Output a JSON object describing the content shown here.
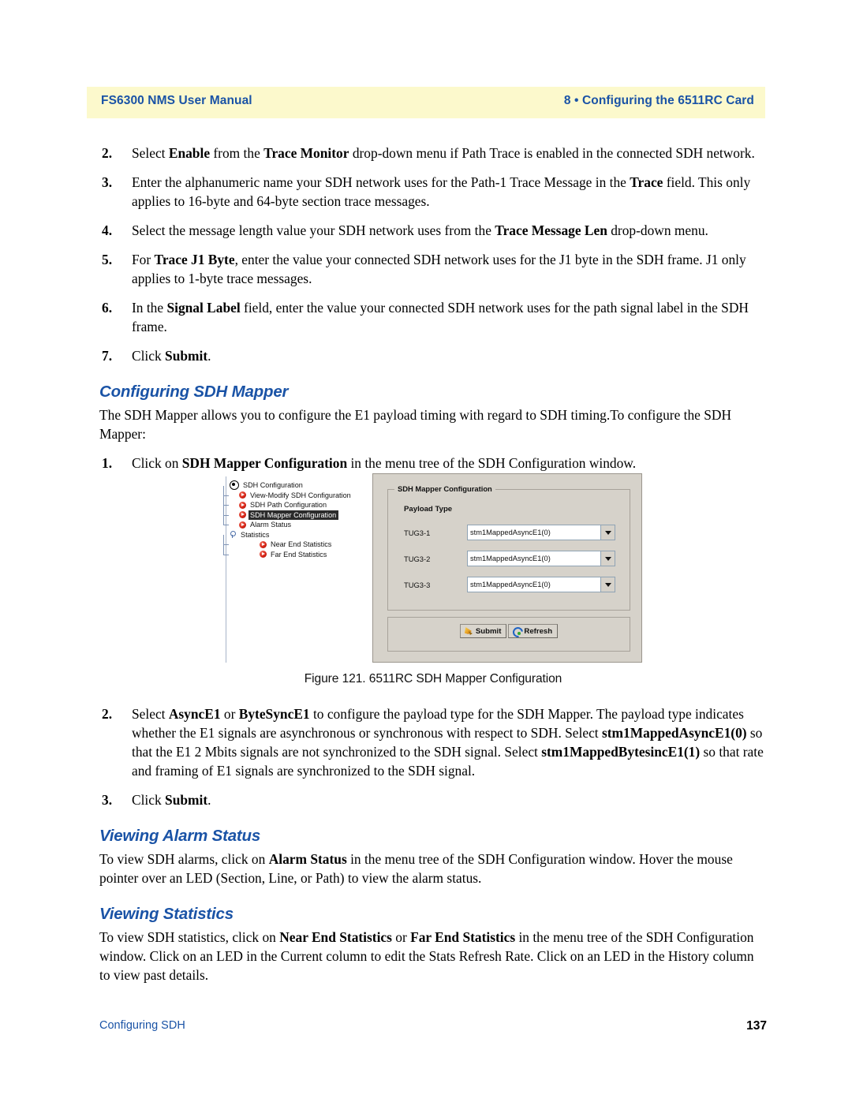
{
  "header": {
    "left": "FS6300 NMS User Manual",
    "right": "8 • Configuring the 6511RC Card",
    "band_color": "#fcf9cc",
    "text_color": "#1a53a6"
  },
  "steps_top": [
    {
      "num": "2.",
      "runs": [
        {
          "t": "Select ",
          "b": false
        },
        {
          "t": "Enable",
          "b": true
        },
        {
          "t": " from the ",
          "b": false
        },
        {
          "t": "Trace Monitor",
          "b": true
        },
        {
          "t": " drop-down menu if Path Trace is enabled in the connected SDH network.",
          "b": false
        }
      ]
    },
    {
      "num": "3.",
      "runs": [
        {
          "t": "Enter the alphanumeric name your SDH network uses for the Path-1 Trace Message in the ",
          "b": false
        },
        {
          "t": "Trace",
          "b": true
        },
        {
          "t": " field. This only applies to 16-byte and 64-byte section trace messages.",
          "b": false
        }
      ]
    },
    {
      "num": "4.",
      "runs": [
        {
          "t": "Select the message length value your SDH network uses from the ",
          "b": false
        },
        {
          "t": "Trace Message Len",
          "b": true
        },
        {
          "t": " drop-down menu.",
          "b": false
        }
      ]
    },
    {
      "num": "5.",
      "runs": [
        {
          "t": "For ",
          "b": false
        },
        {
          "t": "Trace J1 Byte",
          "b": true
        },
        {
          "t": ", enter the value your connected SDH network uses for the J1 byte in the SDH frame. J1 only applies to 1-byte trace messages.",
          "b": false
        }
      ]
    },
    {
      "num": "6.",
      "runs": [
        {
          "t": "In the ",
          "b": false
        },
        {
          "t": "Signal Label",
          "b": true
        },
        {
          "t": " field, enter the value your connected SDH network uses for the path signal label in the SDH frame.",
          "b": false
        }
      ]
    },
    {
      "num": "7.",
      "runs": [
        {
          "t": "Click ",
          "b": false
        },
        {
          "t": "Submit",
          "b": true
        },
        {
          "t": ".",
          "b": false
        }
      ]
    }
  ],
  "section_mapper": {
    "heading": "Configuring SDH Mapper",
    "intro": "The SDH Mapper allows you to configure the E1 payload timing with regard to SDH timing.To configure the SDH Mapper:",
    "step1": {
      "num": "1.",
      "runs": [
        {
          "t": "Click on ",
          "b": false
        },
        {
          "t": "SDH Mapper Configuration",
          "b": true
        },
        {
          "t": " in the menu tree of the SDH Configuration window.",
          "b": false
        }
      ]
    }
  },
  "figure": {
    "caption": "Figure 121. 6511RC SDH Mapper Configuration",
    "tree": [
      {
        "label": "SDH Configuration",
        "icon": "radio-node-icon",
        "level": 0,
        "selected": false
      },
      {
        "label": "View-Modify SDH Configuration",
        "icon": "red-play-icon",
        "level": 1,
        "selected": false
      },
      {
        "label": "SDH Path Configuration",
        "icon": "red-play-icon",
        "level": 1,
        "selected": false
      },
      {
        "label": "SDH Mapper Configuration",
        "icon": "red-play-icon",
        "level": 1,
        "selected": true
      },
      {
        "label": "Alarm Status",
        "icon": "red-play-icon",
        "level": 1,
        "selected": false
      },
      {
        "label": "Statistics",
        "icon": "expand-handle-icon",
        "level": 0,
        "selected": false
      },
      {
        "label": "Near End Statistics",
        "icon": "red-play-icon",
        "level": 2,
        "selected": false
      },
      {
        "label": "Far End Statistics",
        "icon": "red-play-icon",
        "level": 2,
        "selected": false
      }
    ],
    "panel": {
      "group_title": "SDH Mapper Configuration",
      "payload_label": "Payload Type",
      "rows": [
        {
          "label": "TUG3-1",
          "value": "stm1MappedAsyncE1(0)"
        },
        {
          "label": "TUG3-2",
          "value": "stm1MappedAsyncE1(0)"
        },
        {
          "label": "TUG3-3",
          "value": "stm1MappedAsyncE1(0)"
        }
      ],
      "buttons": [
        {
          "label": "Submit",
          "icon": "submit-pen-icon"
        },
        {
          "label": "Refresh",
          "icon": "refresh-circular-arrow-icon"
        }
      ]
    }
  },
  "steps_after_figure": [
    {
      "num": "2.",
      "runs": [
        {
          "t": "Select ",
          "b": false
        },
        {
          "t": "AsyncE1",
          "b": true
        },
        {
          "t": " or ",
          "b": false
        },
        {
          "t": "ByteSyncE1",
          "b": true
        },
        {
          "t": " to configure the payload type for the SDH Mapper. The payload type indicates whether the E1 signals are asynchronous or synchronous with respect to SDH. Select ",
          "b": false
        },
        {
          "t": "stm1MappedAsyncE1(0)",
          "b": true
        },
        {
          "t": " so that the E1 2 Mbits signals are not synchronized to the SDH signal. Select ",
          "b": false
        },
        {
          "t": "stm1MappedBytesincE1(1)",
          "b": true
        },
        {
          "t": " so that rate and framing of E1 signals are synchronized to the SDH signal.",
          "b": false
        }
      ]
    },
    {
      "num": "3.",
      "runs": [
        {
          "t": "Click ",
          "b": false
        },
        {
          "t": "Submit",
          "b": true
        },
        {
          "t": ".",
          "b": false
        }
      ]
    }
  ],
  "section_alarm": {
    "heading": "Viewing Alarm Status",
    "runs": [
      {
        "t": "To view SDH alarms, click on ",
        "b": false
      },
      {
        "t": "Alarm Status",
        "b": true
      },
      {
        "t": " in the menu tree of the SDH Configuration window. Hover the mouse pointer over an LED (Section, Line, or Path) to view the alarm status.",
        "b": false
      }
    ]
  },
  "section_stats": {
    "heading": "Viewing Statistics",
    "runs": [
      {
        "t": "To view SDH statistics, click on ",
        "b": false
      },
      {
        "t": "Near End Statistics",
        "b": true
      },
      {
        "t": " or ",
        "b": false
      },
      {
        "t": "Far End Statistics",
        "b": true
      },
      {
        "t": " in the menu tree of the SDH Configuration window. Click on an LED in the Current column to edit the Stats Refresh Rate. Click on an LED in the History column to view past details.",
        "b": false
      }
    ]
  },
  "footer": {
    "left": "Configuring SDH",
    "right": "137"
  }
}
